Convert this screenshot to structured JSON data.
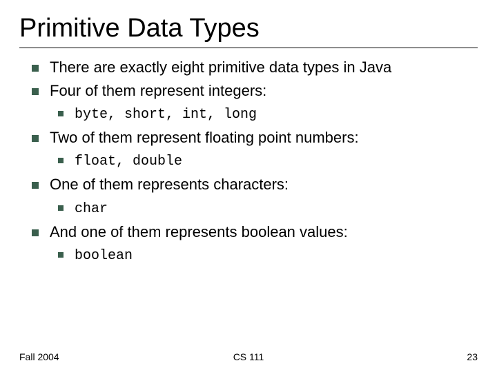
{
  "title": "Primitive Data Types",
  "bullets": {
    "b1": "There are exactly eight primitive data types in Java",
    "b2": "Four of them represent integers:",
    "b2a": "byte, short, int, long",
    "b3": "Two of them represent floating point numbers:",
    "b3a": "float, double",
    "b4": "One of them represents characters:",
    "b4a": "char",
    "b5": "And one of them represents boolean values:",
    "b5a": "boolean"
  },
  "footer": {
    "left": "Fall 2004",
    "center": "CS 111",
    "right": "23"
  }
}
